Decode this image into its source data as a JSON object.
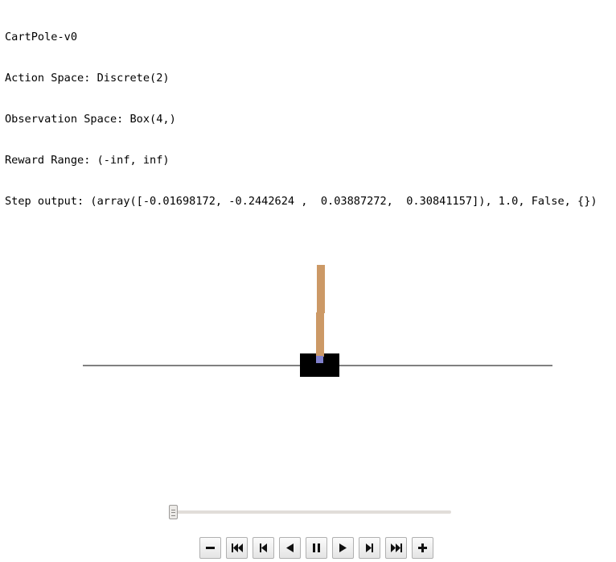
{
  "output": {
    "lines": [
      "CartPole-v0",
      "Action Space: Discrete(2)",
      "Observation Space: Box(4,)",
      "Reward Range: (-inf, inf)",
      "Step output: (array([-0.01698172, -0.2442624 ,  0.03887272,  0.30841157]), 1.0, False, {})"
    ]
  },
  "animation": {
    "frame_position": 0.0,
    "controls": [
      {
        "name": "slower-button",
        "icon": "minus-icon"
      },
      {
        "name": "first-frame-button",
        "icon": "skip-to-start-icon"
      },
      {
        "name": "previous-frame-button",
        "icon": "step-back-icon"
      },
      {
        "name": "play-reverse-button",
        "icon": "play-reverse-icon"
      },
      {
        "name": "pause-button",
        "icon": "pause-icon"
      },
      {
        "name": "play-button",
        "icon": "play-icon"
      },
      {
        "name": "next-frame-button",
        "icon": "step-forward-icon"
      },
      {
        "name": "last-frame-button",
        "icon": "skip-to-end-icon"
      },
      {
        "name": "faster-button",
        "icon": "plus-icon"
      }
    ]
  },
  "colors": {
    "cart": "#000000",
    "pole": "#cc9966",
    "axle": "#8080cc",
    "track": "#000000"
  }
}
